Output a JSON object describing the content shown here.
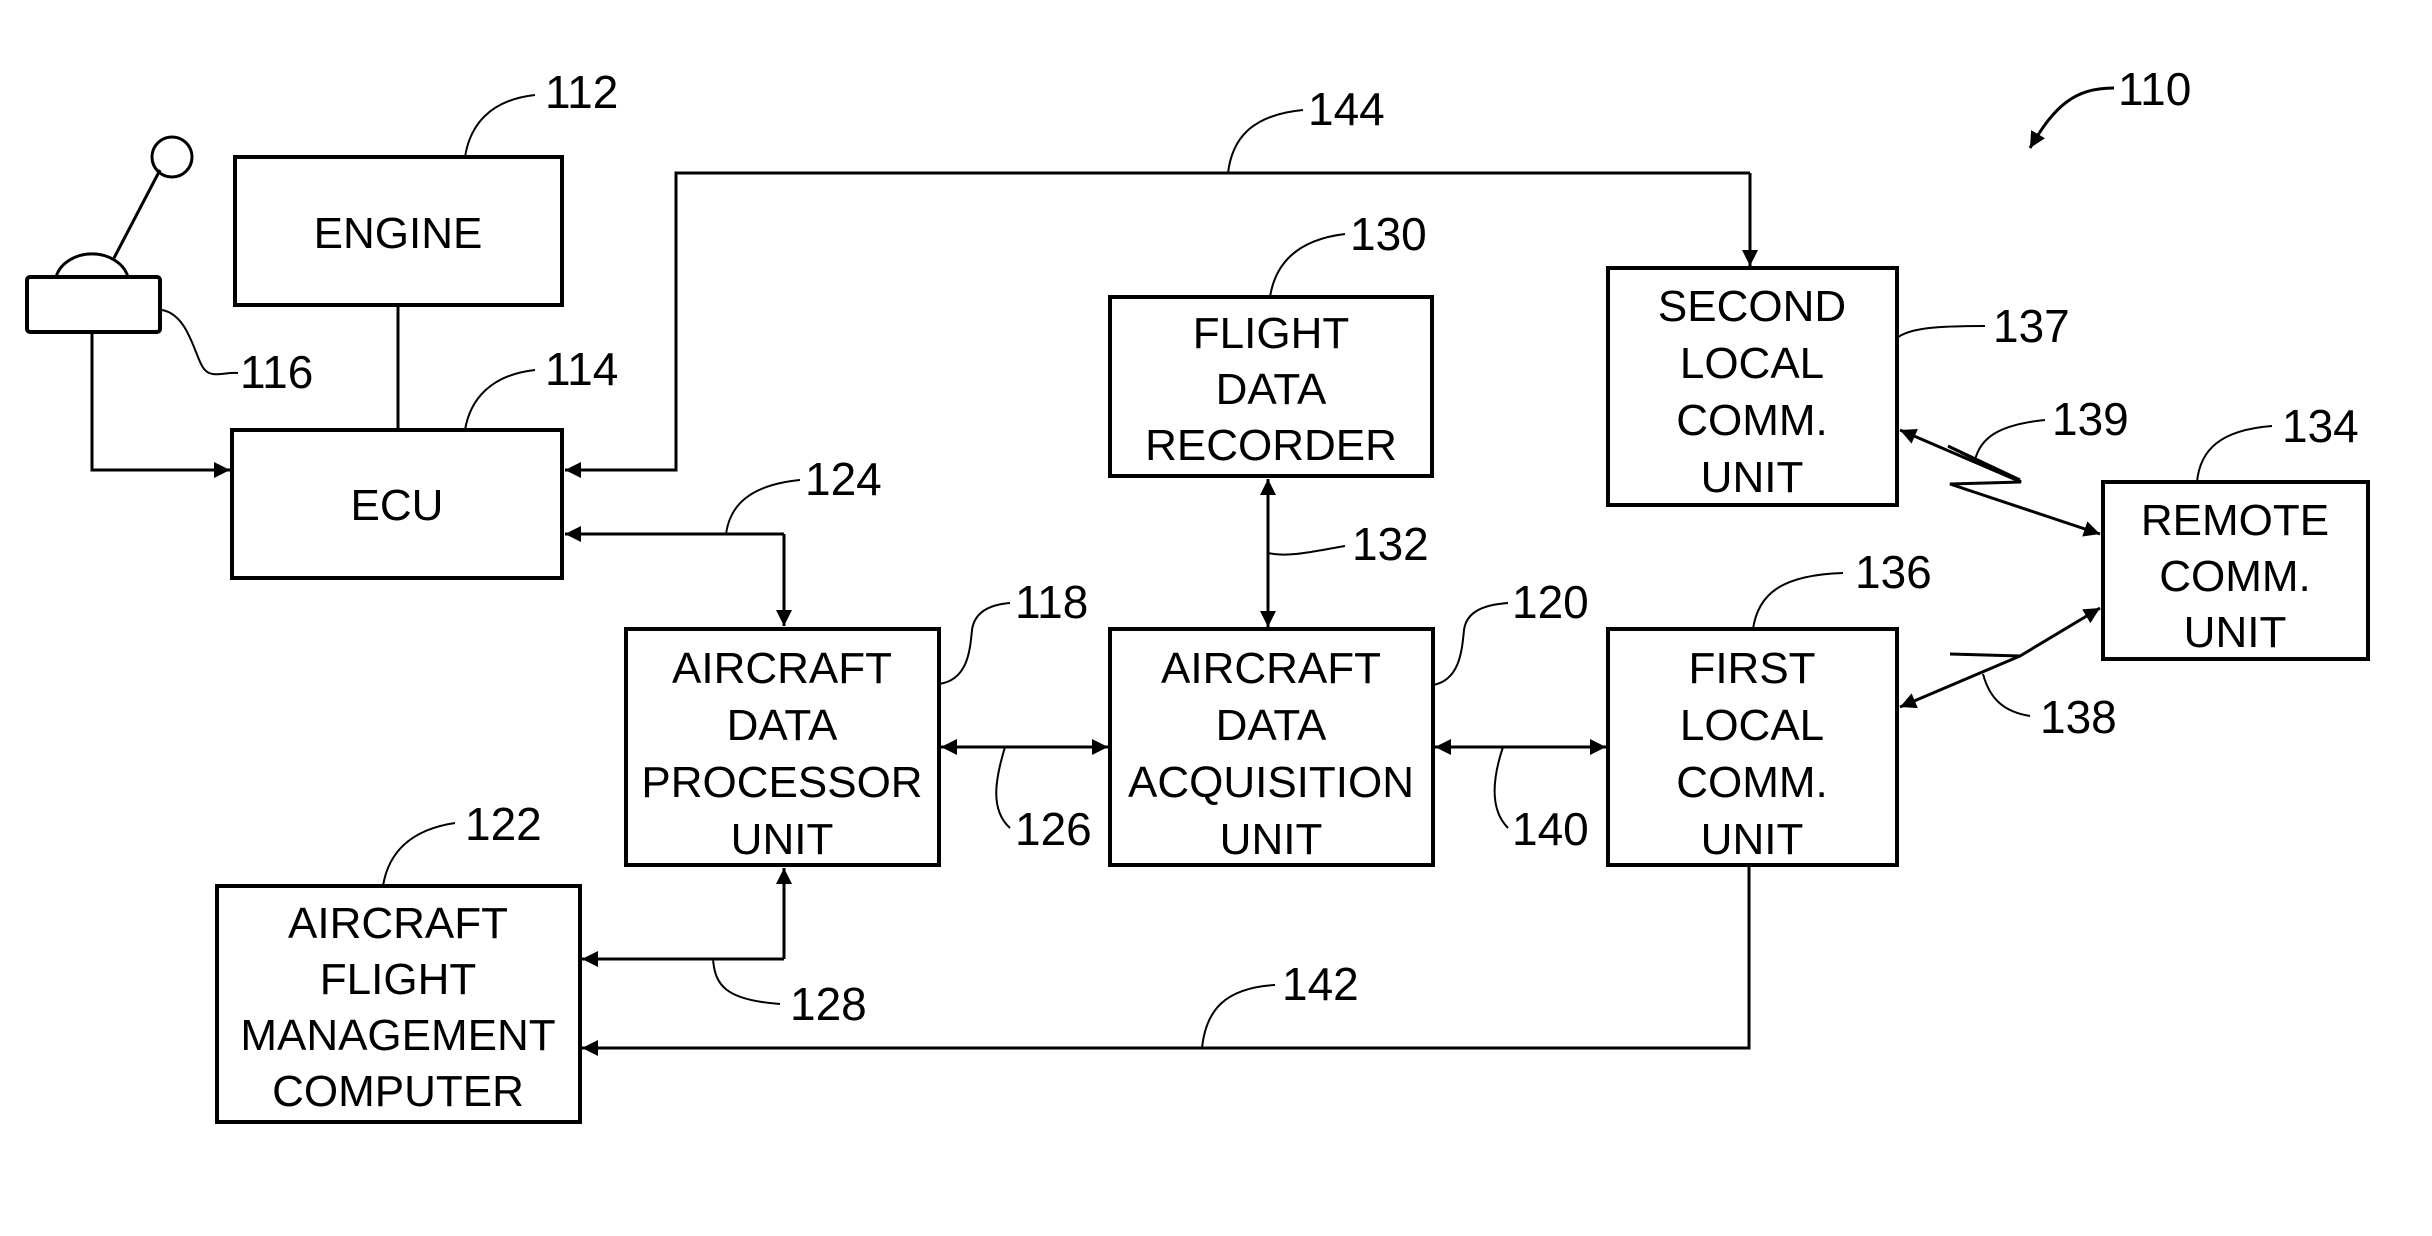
{
  "figure": {
    "ref": "110",
    "blocks": {
      "engine": {
        "ref": "112",
        "lines": [
          "ENGINE"
        ]
      },
      "ecu": {
        "ref": "114",
        "lines": [
          "ECU"
        ]
      },
      "throttle": {
        "ref": "116"
      },
      "adp": {
        "ref": "118",
        "lines": [
          "AIRCRAFT",
          "DATA",
          "PROCESSOR",
          "UNIT"
        ]
      },
      "ada": {
        "ref": "120",
        "lines": [
          "AIRCRAFT",
          "DATA",
          "ACQUISITION",
          "UNIT"
        ]
      },
      "afmc": {
        "ref": "122",
        "lines": [
          "AIRCRAFT",
          "FLIGHT",
          "MANAGEMENT",
          "COMPUTER"
        ]
      },
      "fdr": {
        "ref": "130",
        "lines": [
          "FLIGHT",
          "DATA",
          "RECORDER"
        ]
      },
      "remote": {
        "ref": "134",
        "lines": [
          "REMOTE",
          "COMM.",
          "UNIT"
        ]
      },
      "first_local": {
        "ref": "136",
        "lines": [
          "FIRST",
          "LOCAL",
          "COMM.",
          "UNIT"
        ]
      },
      "second_local": {
        "ref": "137",
        "lines": [
          "SECOND",
          "LOCAL",
          "COMM.",
          "UNIT"
        ]
      }
    },
    "links": {
      "l124": "124",
      "l126": "126",
      "l128": "128",
      "l132": "132",
      "l138": "138",
      "l139": "139",
      "l140": "140",
      "l142": "142",
      "l144": "144"
    }
  }
}
